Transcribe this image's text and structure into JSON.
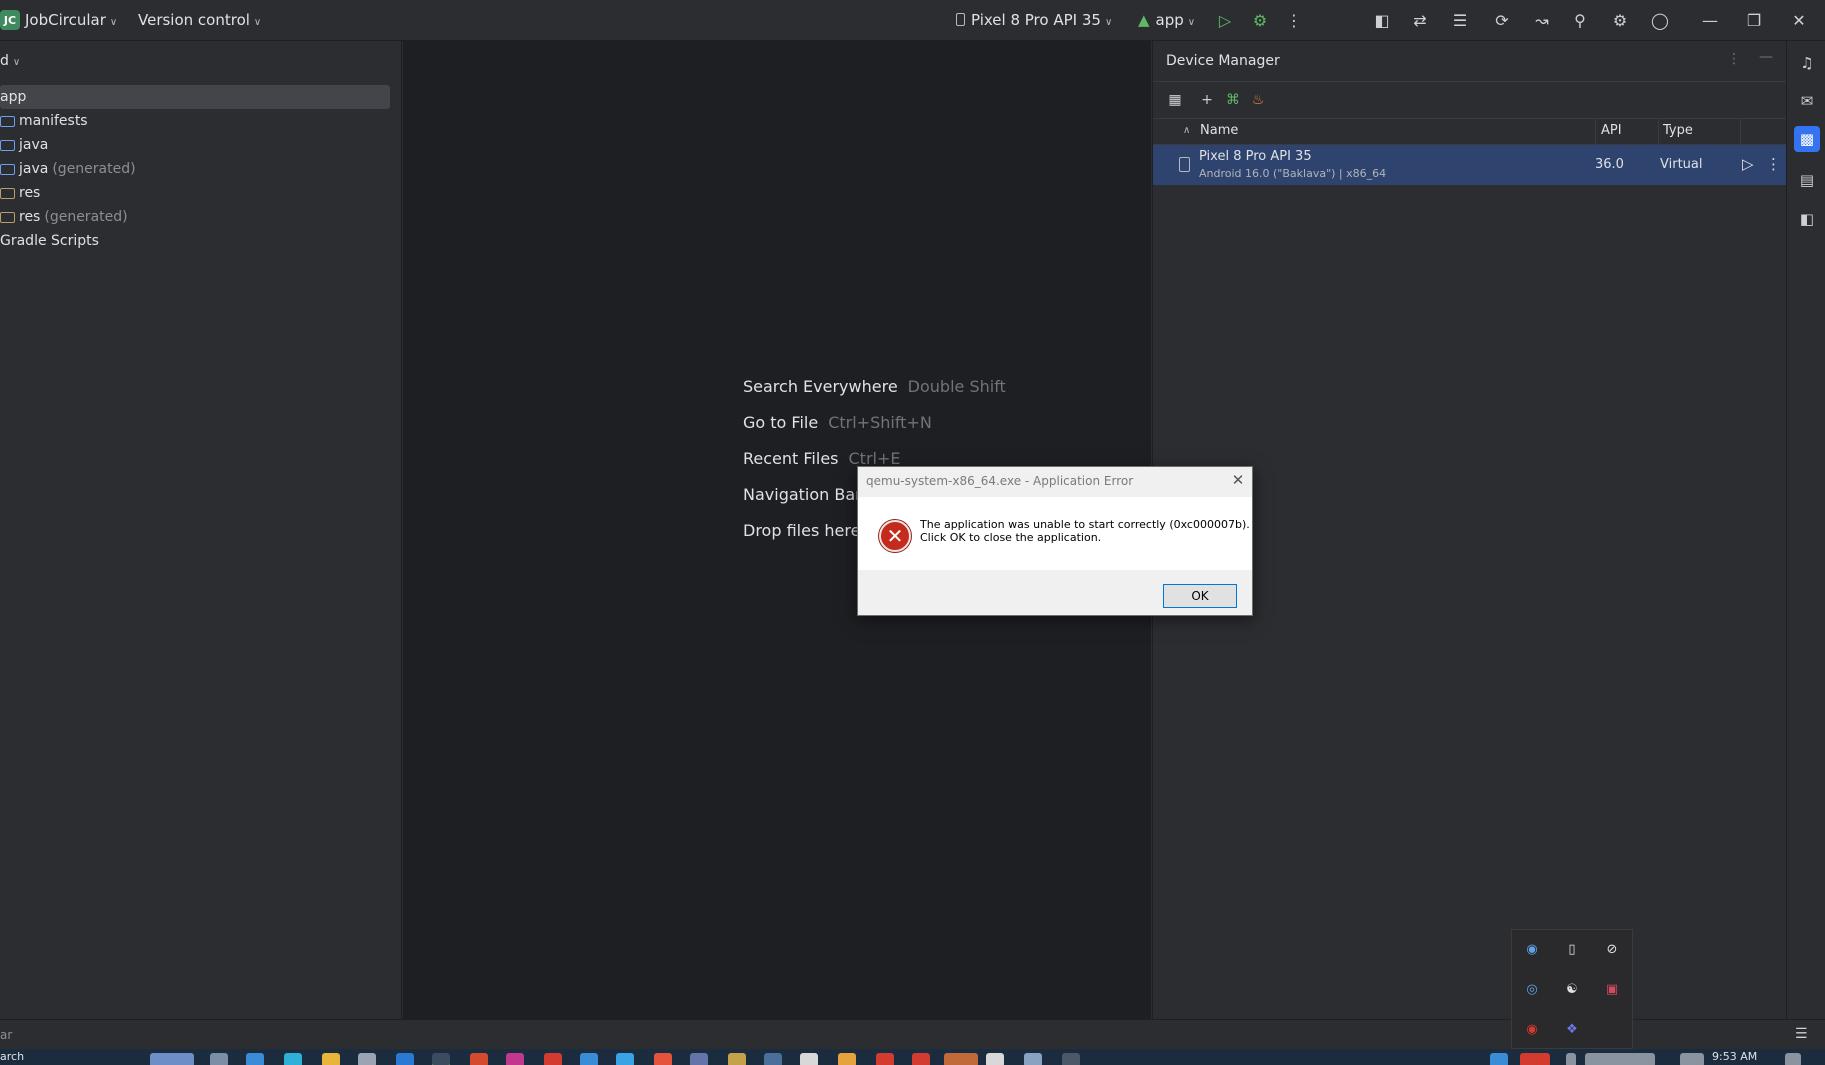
{
  "titlebar": {
    "project_badge": "JC",
    "project_name": "JobCircular",
    "vcs": "Version control",
    "device": "Pixel 8 Pro API 35",
    "run_config": "app"
  },
  "project_panel": {
    "header": "d",
    "items": [
      {
        "label": "app",
        "suffix": ""
      },
      {
        "label": "manifests",
        "suffix": ""
      },
      {
        "label": "java",
        "suffix": ""
      },
      {
        "label": "java",
        "suffix": "(generated)"
      },
      {
        "label": "res",
        "suffix": ""
      },
      {
        "label": "res",
        "suffix": "(generated)"
      },
      {
        "label": "Gradle Scripts",
        "suffix": ""
      }
    ]
  },
  "editor_hints": [
    {
      "action": "Search Everywhere",
      "key": "Double Shift"
    },
    {
      "action": "Go to File",
      "key": "Ctrl+Shift+N"
    },
    {
      "action": "Recent Files",
      "key": "Ctrl+E"
    },
    {
      "action": "Navigation Bar",
      "key": ""
    },
    {
      "action": "Drop files here",
      "key": ""
    }
  ],
  "device_manager": {
    "title": "Device Manager",
    "columns": {
      "name": "Name",
      "api": "API",
      "type": "Type"
    },
    "device": {
      "name": "Pixel 8 Pro API 35",
      "details": "Android 16.0 (\"Baklava\") | x86_64",
      "api": "36.0",
      "type": "Virtual"
    }
  },
  "statusbar": {
    "text": "ar"
  },
  "taskbar": {
    "search": "arch",
    "clock": "9:53 AM"
  },
  "dialog": {
    "title": "qemu-system-x86_64.exe - Application Error",
    "message_line1": "The application was unable to start correctly (0xc000007b).",
    "message_line2": "Click OK to close the application.",
    "ok": "OK"
  },
  "colors": {
    "accent": "#3574f0",
    "selected_row": "#2e436e",
    "error": "#c42b1c",
    "run_green": "#5fb865"
  }
}
